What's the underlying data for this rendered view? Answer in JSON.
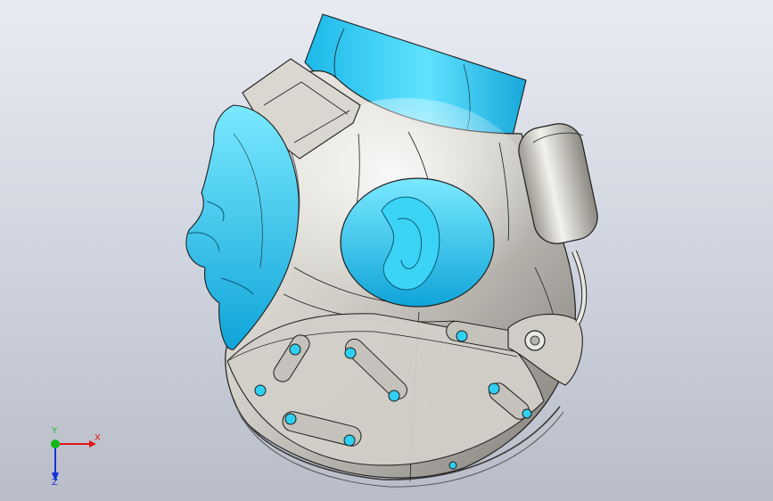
{
  "viewport": {
    "background_top": "#e9ebf2",
    "background_bottom": "#b9bdc9"
  },
  "model": {
    "surface_metal": "#c8c6bf",
    "surface_highlight": "#f4f3ee",
    "surface_cyan": "#2fd0f2",
    "edge_color": "#1e1e1e"
  },
  "triad": {
    "x_label": "X",
    "y_label": "Y",
    "z_label": "Z",
    "x_color": "#e01818",
    "y_color": "#18b818",
    "z_color": "#1830d8"
  }
}
